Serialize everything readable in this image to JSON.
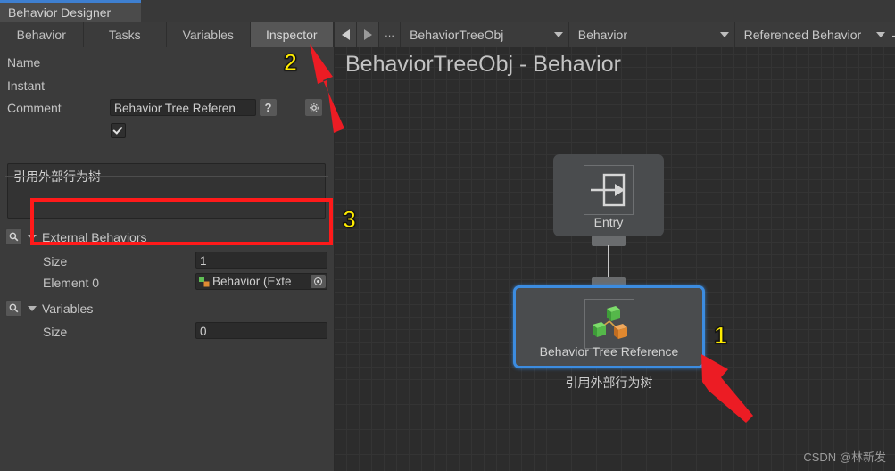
{
  "window": {
    "title": "Behavior Designer",
    "accent_color": "#3e7fd0"
  },
  "tabs": [
    {
      "label": "Behavior",
      "active": false
    },
    {
      "label": "Tasks",
      "active": false
    },
    {
      "label": "Variables",
      "active": false
    },
    {
      "label": "Inspector",
      "active": true
    }
  ],
  "graph_toolbar": {
    "back_icon": "arrow-left-icon",
    "forward_icon": "arrow-right-icon",
    "overflow_label": "...",
    "object_dropdown": "BehaviorTreeObj",
    "behavior_dropdown": "Behavior",
    "referenced_dropdown": "Referenced Behavior",
    "minus_label": "-"
  },
  "inspector": {
    "name_label": "Name",
    "name_value": "Behavior Tree Referen",
    "help_label": "?",
    "instant_label": "Instant",
    "instant_checked": true,
    "comment_label": "Comment",
    "comment_value": "引用外部行为树",
    "external_behaviors": {
      "title": "External Behaviors",
      "size_label": "Size",
      "size_value": "1",
      "element_label": "Element 0",
      "element_value": "Behavior (Exte"
    },
    "variables": {
      "title": "Variables",
      "size_label": "Size",
      "size_value": "0"
    }
  },
  "graph": {
    "title": "BehaviorTreeObj - Behavior",
    "nodes": [
      {
        "label": "Entry",
        "icon": "entry-arrow-icon",
        "selected": false
      },
      {
        "label": "Behavior Tree Reference",
        "icon": "behavior-tree-cubes-icon",
        "selected": true
      }
    ],
    "node_note": "引用外部行为树",
    "watermark": "CSDN @林新发"
  },
  "annotations": {
    "marker_1": "1",
    "marker_2": "2",
    "marker_3": "3",
    "highlight_color": "#ff1a1a",
    "marker_color": "#ffec00"
  }
}
